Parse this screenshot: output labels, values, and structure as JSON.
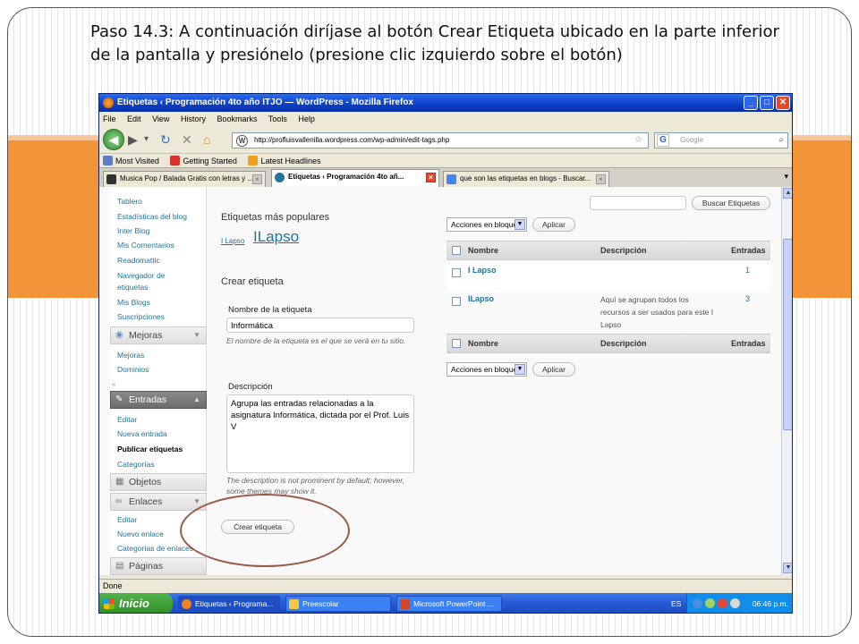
{
  "caption": "Paso 14.3: A continuación diríjase al botón Crear Etiqueta ubicado en la parte inferior de la pantalla y presiónelo (presione clic izquierdo sobre el botón)",
  "window": {
    "title": "Etiquetas ‹ Programación 4to año ITJO — WordPress - Mozilla Firefox",
    "min": "_",
    "max": "□",
    "close": "✕"
  },
  "menu": [
    "File",
    "Edit",
    "View",
    "History",
    "Bookmarks",
    "Tools",
    "Help"
  ],
  "nav": {
    "url": "http://profluisvallenilla.wordpress.com/wp-admin/edit-tags.php",
    "search_placeholder": "Google",
    "search_engine": "G",
    "wp_glyph": "W"
  },
  "bookmarks": [
    {
      "label": "Most Visited",
      "color": "#5b7fc7"
    },
    {
      "label": "Getting Started",
      "color": "#d9322a"
    },
    {
      "label": "Latest Headlines",
      "color": "#f0a020"
    }
  ],
  "tabs": [
    {
      "label": "Musica Pop / Balada Gratis con letras y ...",
      "active": false,
      "color": "#333"
    },
    {
      "label": "Etiquetas ‹ Programación 4to añ...",
      "active": true,
      "color": "#21759b"
    },
    {
      "label": "que son las etiquetas en blogs - Buscar...",
      "active": false,
      "color": "#4285f4"
    }
  ],
  "sidebar": {
    "links_top": [
      "Tablero",
      "Estadísticas del blog",
      "Inter Blog",
      "Mis Comentarios",
      "Readomattic",
      "Navegador de",
      "etiquetas",
      "Mis Blogs",
      "Suscripciones"
    ],
    "mejoras": {
      "title": "Mejoras",
      "items": [
        "Mejoras",
        "Dominios"
      ]
    },
    "entradas": {
      "title": "Entradas",
      "items": [
        "Editar",
        "Nueva entrada",
        "Publicar etiquetas",
        "Categorías"
      ]
    },
    "objetos": {
      "title": "Objetos"
    },
    "enlaces": {
      "title": "Enlaces",
      "items": [
        "Editar",
        "Nuevo enlace",
        "Categorías de enlaces"
      ]
    },
    "paginas": {
      "title": "Páginas"
    }
  },
  "main": {
    "popular_title": "Etiquetas más populares",
    "popular_tags": [
      "I Lapso",
      "ILapso"
    ],
    "create_title": "Crear etiqueta",
    "name_label": "Nombre de la etiqueta",
    "name_value": "Informática",
    "name_hint": "El nombre de la etiqueta es el que se verá en tu sitio.",
    "desc_label": "Descripción",
    "desc_value": "Agrupa las entradas relacionadas a la asignatura Informática, dictada por el Prof. Luis V",
    "desc_hint": "The description is not prominent by default; however, some themes may show it.",
    "create_button": "Crear etiqueta"
  },
  "table": {
    "search_button": "Buscar Etiquetas",
    "bulk_select": "Acciones en bloque",
    "apply_button": "Aplicar",
    "columns": [
      "Nombre",
      "Descripción",
      "Entradas"
    ],
    "rows": [
      {
        "name": "I Lapso",
        "description": "",
        "count": "1"
      },
      {
        "name": "ILapso",
        "description": "Aquí se agrupan todos los recursos a ser usados para este I Lapso",
        "count": "3"
      }
    ]
  },
  "status": "Done",
  "taskbar": {
    "start": "Inicio",
    "tasks": [
      {
        "label": "Etiquetas ‹ Programa...",
        "color": "#f08020"
      },
      {
        "label": "Preescolar",
        "color": "#f5c842"
      },
      {
        "label": "Microsoft PowerPoint ...",
        "color": "#d24726"
      }
    ],
    "lang": "ES",
    "clock": "06:46 p.m."
  }
}
